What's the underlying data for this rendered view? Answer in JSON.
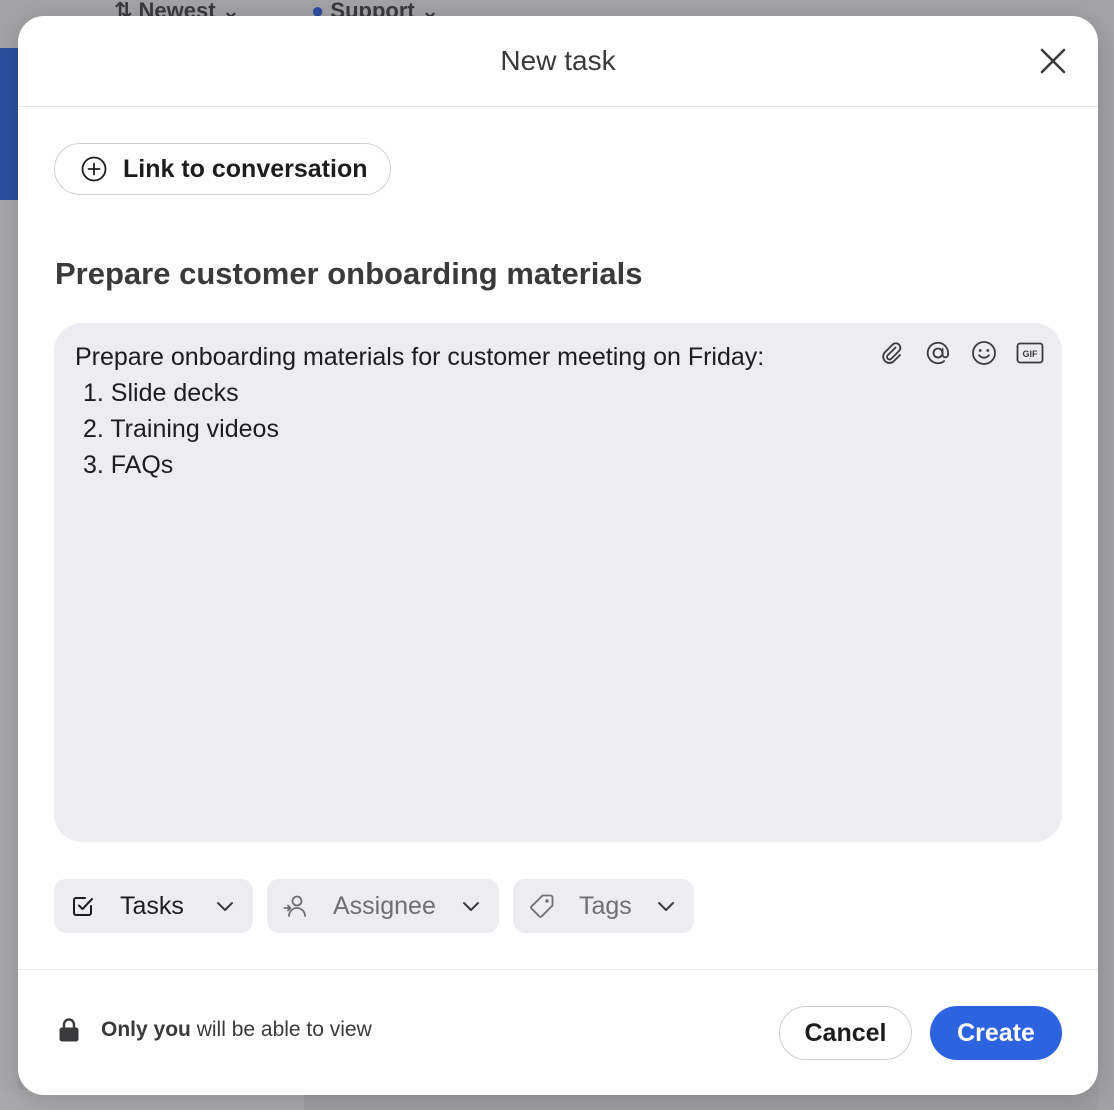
{
  "background": {
    "sort_label": "Newest",
    "filter_label": "Support"
  },
  "modal": {
    "title": "New task",
    "link_button_label": "Link to conversation",
    "task_title": "Prepare customer onboarding materials",
    "editor": {
      "intro": "Prepare onboarding materials for customer meeting on Friday:",
      "items": [
        "1. Slide decks",
        "2. Training videos",
        "3. FAQs"
      ],
      "tools": [
        "paperclip-icon",
        "at-mention-icon",
        "emoji-icon",
        "gif-icon"
      ],
      "gif_label": "GIF"
    },
    "pills": {
      "tasks": "Tasks",
      "assignee": "Assignee",
      "tags": "Tags"
    },
    "privacy": {
      "bold": "Only you",
      "rest": " will be able to view"
    },
    "buttons": {
      "cancel": "Cancel",
      "create": "Create"
    }
  },
  "colors": {
    "accent": "#2e63e0",
    "editor_bg": "#ececf1",
    "text": "#1d1d1f"
  }
}
